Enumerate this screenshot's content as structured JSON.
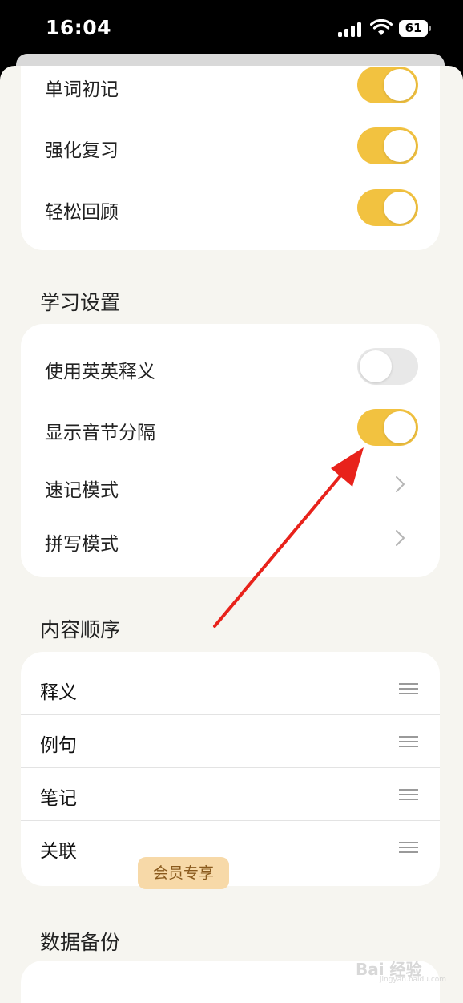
{
  "status_bar": {
    "time": "16:04",
    "battery": "61"
  },
  "review_modes": {
    "items": [
      {
        "label": "单词初记",
        "on": true
      },
      {
        "label": "强化复习",
        "on": true
      },
      {
        "label": "轻松回顾",
        "on": true
      }
    ]
  },
  "study_settings": {
    "title": "学习设置",
    "toggles": [
      {
        "label": "使用英英释义",
        "on": false
      },
      {
        "label": "显示音节分隔",
        "on": true
      }
    ],
    "links": [
      {
        "label": "速记模式"
      },
      {
        "label": "拼写模式"
      }
    ]
  },
  "content_order": {
    "title": "内容顺序",
    "items": [
      "释义",
      "例句",
      "笔记",
      "关联"
    ]
  },
  "data_backup": {
    "title": "数据备份",
    "badge": "会员专享"
  },
  "watermark": {
    "text": "Bai 经验",
    "sub": "jingyan.baidu.com"
  },
  "colors": {
    "toggle_on": "#f2c240",
    "toggle_off": "#e8e8e8",
    "annotation_arrow": "#e8221b",
    "badge_bg": "#f7d9a8"
  }
}
